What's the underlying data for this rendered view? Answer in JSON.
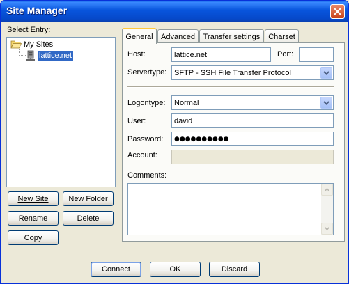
{
  "window": {
    "title": "Site Manager"
  },
  "sidebar": {
    "select_entry_label": "Select Entry:",
    "tree": {
      "root": "My Sites",
      "items": [
        "lattice.net"
      ],
      "selected": "lattice.net"
    },
    "buttons": {
      "new_site": "New Site",
      "new_folder": "New Folder",
      "rename": "Rename",
      "delete": "Delete",
      "copy": "Copy"
    }
  },
  "tabs": [
    {
      "label": "General",
      "active": true
    },
    {
      "label": "Advanced",
      "active": false
    },
    {
      "label": "Transfer settings",
      "active": false
    },
    {
      "label": "Charset",
      "active": false
    }
  ],
  "general": {
    "host": {
      "label": "Host:",
      "value": "lattice.net"
    },
    "port": {
      "label": "Port:",
      "value": ""
    },
    "servertype": {
      "label": "Servertype:",
      "value": "SFTP - SSH File Transfer Protocol"
    },
    "logontype": {
      "label": "Logontype:",
      "value": "Normal"
    },
    "user": {
      "label": "User:",
      "value": "david"
    },
    "password": {
      "label": "Password:",
      "value": "●●●●●●●●●●"
    },
    "account": {
      "label": "Account:",
      "value": ""
    },
    "comments": {
      "label": "Comments:",
      "value": ""
    }
  },
  "footer": {
    "connect": "Connect",
    "ok": "OK",
    "discard": "Discard"
  },
  "colors": {
    "titlebar": "#0a55dd",
    "selection": "#3169c6",
    "active_tab_accent": "#ffc83c"
  }
}
